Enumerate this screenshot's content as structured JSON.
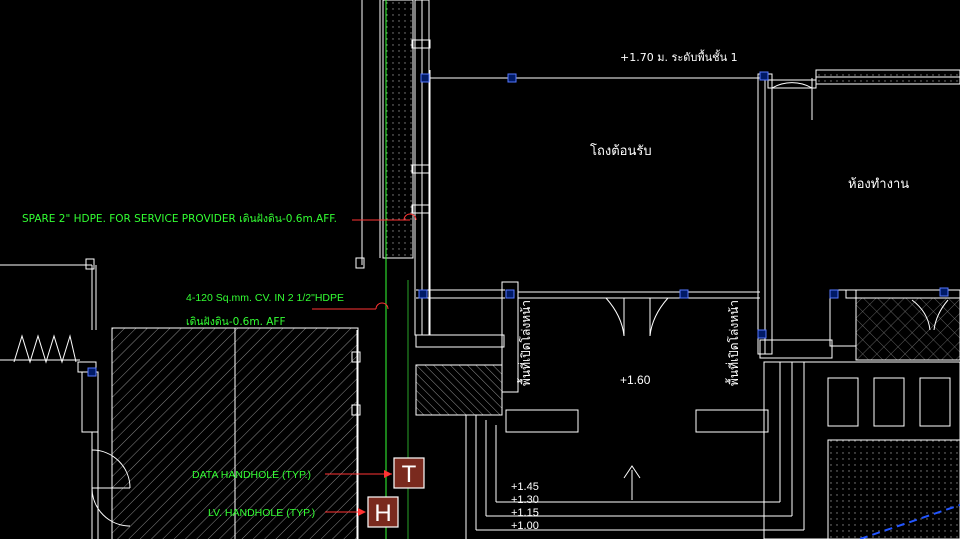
{
  "labels": {
    "level_top": "+1.70 ม. ระดับพื้นชั้น 1",
    "lobby": "โถงต้อนรับ",
    "office": "ห้องทำงาน",
    "spare_conduit": "SPARE 2\" HDPE. FOR SERVICE PROVIDER เดินฝังดิน-0.6m.AFF.",
    "cable_line1": "4-120 Sq.mm. CV. IN 2 1/2\"HDPE",
    "cable_line2": "เดินฝังดิน-0.6m. AFF",
    "vertical_left": "พื้นที่เปิดโล่งหน้า",
    "vertical_right": "พื้นที่เปิดโล่งหน้า",
    "level_mid": "+1.60",
    "data_handhole": "DATA HANDHOLE (TYP.)",
    "lv_handhole": "LV. HANDHOLE (TYP.)",
    "tag_t": "T",
    "tag_h": "H",
    "step_1": "+1.45",
    "step_2": "+1.30",
    "step_3": "+1.15",
    "step_4": "+1.00"
  },
  "colors": {
    "background": "#000000",
    "wall": "#ffffff",
    "annotation": "#33ff33",
    "leader": "#ff3333",
    "tag_fill": "#7a2a1e",
    "hatch": "#bbbbbb",
    "grid": "#2255ff"
  }
}
